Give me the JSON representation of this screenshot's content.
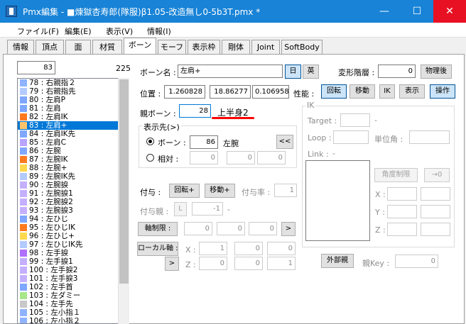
{
  "window": {
    "title": "Pmx編集 - ■煉獄杏寿郎(隊服)β1.05-改造無し0-5b3T.pmx *",
    "minimize": "—",
    "maximize": "☐",
    "close": "✕"
  },
  "menu": [
    "ファイル(F)",
    "編集(E)",
    "表示(V)",
    "情報(I)"
  ],
  "tabs": [
    "情報",
    "頂点",
    "面",
    "材質",
    "ボーン",
    "モーフ",
    "表示枠",
    "剛体",
    "Joint",
    "SoftBody"
  ],
  "list": {
    "index_value": "83",
    "count": "225",
    "items": [
      {
        "label": "78 : 右親指２",
        "color": "#8fb3ff"
      },
      {
        "label": "79 : 右親指先",
        "color": "#b3ccff"
      },
      {
        "label": "80 : 左肩P",
        "color": "#7fa7ff"
      },
      {
        "label": "81 : 左肩",
        "color": "#7fa7ff"
      },
      {
        "label": "82 : 左肩IK",
        "color": "#ff7a1f"
      },
      {
        "label": "83 : 左肩+",
        "color": "#ffc46b",
        "selected": true
      },
      {
        "label": "84 : 左肩IK先",
        "color": "#7fa7ff"
      },
      {
        "label": "85 : 左肩C",
        "color": "#b8a3ff"
      },
      {
        "label": "86 : 左腕",
        "color": "#7fa7ff"
      },
      {
        "label": "87 : 左腕IK",
        "color": "#ff7a1f"
      },
      {
        "label": "88 : 左腕+",
        "color": "#ffd84d"
      },
      {
        "label": "89 : 左腕IK先",
        "color": "#b3ccff"
      },
      {
        "label": "90 : 左腕捩",
        "color": "#c4b0ff"
      },
      {
        "label": "91 : 左腕捩1",
        "color": "#c4b0ff"
      },
      {
        "label": "92 : 左腕捩2",
        "color": "#c4b0ff"
      },
      {
        "label": "93 : 左腕捩3",
        "color": "#c4b0ff"
      },
      {
        "label": "94 : 左ひじ",
        "color": "#7fa7ff"
      },
      {
        "label": "95 : 左ひじIK",
        "color": "#ff7a1f"
      },
      {
        "label": "96 : 左ひじ+",
        "color": "#ffd84d"
      },
      {
        "label": "97 : 左ひじIK先",
        "color": "#b3ccff"
      },
      {
        "label": "98 : 左手捩",
        "color": "#b070ff"
      },
      {
        "label": "99 : 左手捩1",
        "color": "#c4b0ff"
      },
      {
        "label": "100 : 左手捩2",
        "color": "#c4b0ff"
      },
      {
        "label": "101 : 左手捩3",
        "color": "#c4b0ff"
      },
      {
        "label": "102 : 左手首",
        "color": "#7fa7ff"
      },
      {
        "label": "103 : 左ダミー",
        "color": "#a8e68a"
      },
      {
        "label": "104 : 左手先",
        "color": "#c8c8c8"
      },
      {
        "label": "105 : 左小指１",
        "color": "#8fb3ff"
      },
      {
        "label": "106 : 左小指２",
        "color": "#8fb3ff"
      }
    ]
  },
  "detail": {
    "bone_name_label": "ボーン名 :",
    "bone_name_value": "左肩+",
    "jp_button": "日",
    "en_button": "英",
    "deform_label": "変形階層 :",
    "deform_value": "0",
    "after_physics_button": "物理後",
    "position_label": "位置 :",
    "pos_x": "1.260828",
    "pos_y": "18.86277",
    "pos_z": "0.1069584",
    "perf_label": "性能 :",
    "flags": [
      "回転",
      "移動",
      "IK",
      "表示",
      "操作"
    ],
    "parent_label": "親ボーン :",
    "parent_value": "28",
    "parent_name": "上半身2",
    "display_group_label": "表示先(>)",
    "bone_radio": "ボーン :",
    "bone_value": "86",
    "bone_target_name": "左腕",
    "prev_button": "<<",
    "relative_radio": "相対 :",
    "rel_x": "0",
    "rel_y": "0",
    "rel_z": "0",
    "grant_label": "付与 :",
    "grant_rot_button": "回転+",
    "grant_move_button": "移動+",
    "grant_rate_label": "付与率 :",
    "grant_rate_value": "1",
    "grant_parent_label": "付与親 :",
    "grant_parent_l": "L",
    "grant_parent_value": "-1",
    "grant_parent_dash": "-",
    "axis_limit_button": "軸制限 :",
    "axis_x": "0",
    "axis_y": "0",
    "axis_z": "0",
    "axis_arrow": ">",
    "local_axis_button": "ローカル軸 :",
    "x_label": "X :",
    "z_label": "Z :",
    "lx1": "1",
    "lx2": "0",
    "lx3": "0",
    "lz1": "0",
    "lz2": "0",
    "lz3": "1",
    "local_arrow": ">",
    "external_parent_button": "外部親",
    "parent_key_label": "親Key :",
    "parent_key_value": "0"
  },
  "ik": {
    "title": "IK",
    "target_label": "Target :",
    "target_dash": "-",
    "loop_label": "Loop :",
    "unit_angle_label": "単位角 :",
    "link_label": "Link :",
    "link_dash": "-",
    "angle_limit_button": "角度制限",
    "to_zero_button": "→0",
    "x_label": "X :",
    "y_label": "Y :",
    "z_label": "Z :"
  },
  "colors": {
    "titlebar": "#1883d7",
    "selection": "#0078d7",
    "underline": "#ff0000"
  }
}
